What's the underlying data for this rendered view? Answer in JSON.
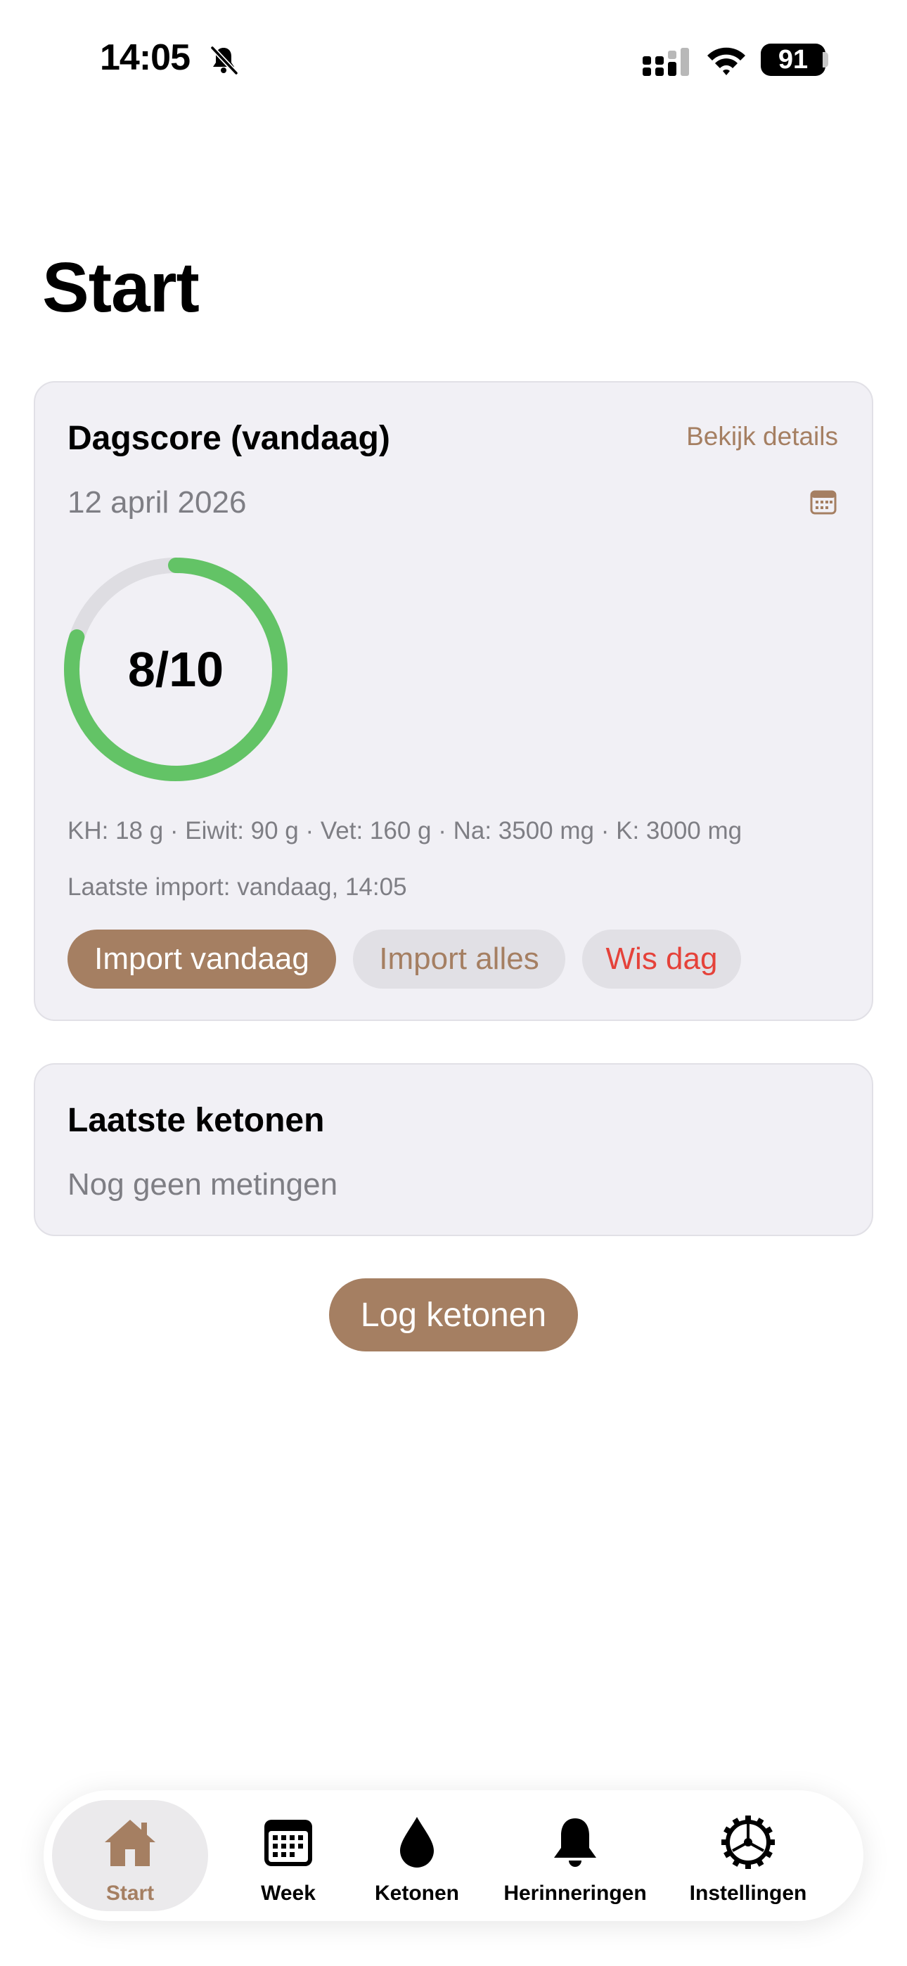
{
  "status_bar": {
    "time": "14:05",
    "battery": "91",
    "icons": [
      "bell-slash-icon",
      "signal-icon",
      "wifi-icon",
      "battery-icon"
    ]
  },
  "page": {
    "title": "Start"
  },
  "score_card": {
    "title": "Dagscore (vandaag)",
    "details_link": "Bekijk details",
    "date": "12 april 2026",
    "score_label": "8/10",
    "score_fraction": 0.8,
    "macros": "KH: 18 g · Eiwit: 90 g · Vet: 160 g · Na: 3500 mg · K: 3000 mg",
    "last_import": "Laatste import: vandaag, 14:05",
    "buttons": {
      "import_today": "Import vandaag",
      "import_all": "Import alles",
      "clear_day": "Wis dag"
    }
  },
  "ketone_card": {
    "title": "Laatste ketonen",
    "empty": "Nog geen metingen"
  },
  "log_button": "Log ketonen",
  "tabbar": {
    "items": [
      {
        "label": "Start",
        "icon": "house-icon",
        "active": true
      },
      {
        "label": "Week",
        "icon": "calendar-icon",
        "active": false
      },
      {
        "label": "Ketonen",
        "icon": "drop-icon",
        "active": false
      },
      {
        "label": "Herinneringen",
        "icon": "bell-icon",
        "active": false
      },
      {
        "label": "Instellingen",
        "icon": "gear-icon",
        "active": false
      }
    ]
  },
  "colors": {
    "accent": "#a57f62",
    "ring": "#63c366",
    "ring_track": "#dedde2",
    "danger": "#e5423a",
    "card_bg": "#f1f0f5"
  }
}
